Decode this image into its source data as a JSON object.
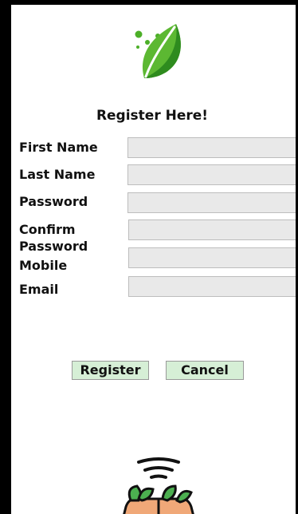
{
  "form": {
    "title": "Register Here!",
    "fields": [
      {
        "label": "First Name",
        "value": "",
        "placeholder": ""
      },
      {
        "label": "Last Name",
        "value": "",
        "placeholder": ""
      },
      {
        "label": "Password",
        "value": "",
        "placeholder": ""
      },
      {
        "label_line1": "Confirm",
        "label_line2": "Password",
        "value": "",
        "placeholder": ""
      },
      {
        "label": "Mobile",
        "value": "",
        "placeholder": ""
      },
      {
        "label": "Email",
        "value": "",
        "placeholder": ""
      }
    ],
    "register_label": "Register",
    "cancel_label": "Cancel"
  },
  "icons": {
    "logo": "leaf-logo-icon",
    "bottom": "plant-sprouts-in-hands-icon"
  },
  "colors": {
    "leaf_light": "#6fbf3a",
    "leaf_dark": "#2e8b1e",
    "button_bg": "#d6efd6",
    "input_bg": "#e9e9e9"
  }
}
